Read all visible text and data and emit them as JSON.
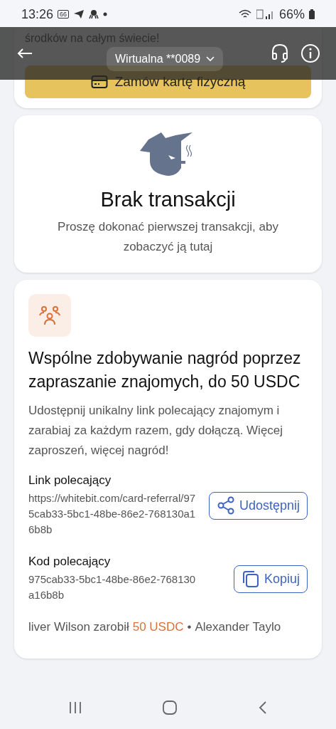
{
  "status_bar": {
    "time": "13:26",
    "badge": "66",
    "battery": "66%"
  },
  "top_bar": {
    "account": "Wirtualna **0089"
  },
  "order_card": {
    "text": "środków na całym świecie!",
    "button": "Zamów kartę fizyczną"
  },
  "empty_state": {
    "title": "Brak transakcji",
    "message": "Proszę dokonać pierwszej transakcji, aby zobaczyć ją tutaj"
  },
  "referral": {
    "title": "Wspólne zdobywanie nagród poprzez zapraszanie znajomych, do 50 USDC",
    "description": "Udostępnij unikalny link polecający znajomym i zarabiaj za każdym razem, gdy dołączą. Więcej zaproszeń, więcej nagród!",
    "fields": [
      {
        "kind": "link",
        "label": "Link polecający",
        "value": "https://whitebit.com/card-referral/975cab33-5bc1-48be-86e2-768130a16b8b",
        "button": "Udostępnij"
      },
      {
        "kind": "code",
        "label": "Kod polecający",
        "value": "975cab33-5bc1-48be-86e2-768130a16b8b",
        "button": "Kopiuj"
      }
    ],
    "ticker": [
      {
        "text": "liver Wilson zarobił",
        "amount": "50 USDC"
      },
      {
        "text": "Alexander Taylo"
      }
    ],
    "separator": "•"
  }
}
